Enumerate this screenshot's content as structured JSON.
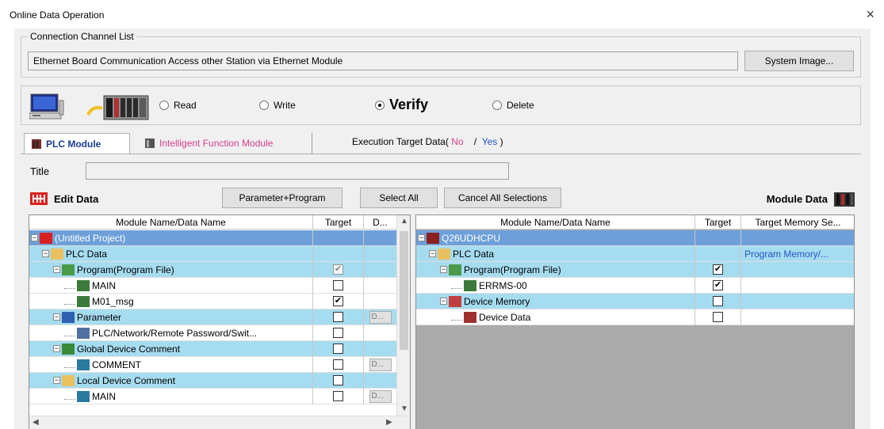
{
  "window": {
    "title": "Online Data Operation",
    "close": "×"
  },
  "channel": {
    "group_label": "Connection Channel List",
    "text": "Ethernet Board Communication  Access other Station via Ethernet Module",
    "system_image_label": "System Image..."
  },
  "operation": {
    "read": "Read",
    "write": "Write",
    "verify": "Verify",
    "delete": "Delete",
    "selected": "Verify"
  },
  "tabs": {
    "plc_module": "PLC Module",
    "intelligent": "Intelligent Function Module",
    "exec_prefix": "Execution Target Data(",
    "exec_no": "No",
    "exec_sep": "/",
    "exec_yes": "Yes",
    "exec_suffix": ")"
  },
  "title_field": {
    "label": "Title",
    "value": ""
  },
  "toolbar": {
    "edit_data": "Edit Data",
    "param_program": "Parameter+Program",
    "select_all": "Select All",
    "cancel_all": "Cancel All Selections",
    "module_data": "Module Data"
  },
  "left_grid": {
    "headers": [
      "Module Name/Data Name",
      "Target",
      "D..."
    ],
    "rows": [
      {
        "label": "(Untitled Project)",
        "level": 0,
        "style": "sel",
        "icon": "project-icon",
        "target": "",
        "detail": ""
      },
      {
        "label": "PLC Data",
        "level": 1,
        "style": "blue",
        "icon": "folder-icon",
        "target": "",
        "detail": ""
      },
      {
        "label": "Program(Program File)",
        "level": 2,
        "style": "blue",
        "icon": "program-icon",
        "target": "grey",
        "detail": ""
      },
      {
        "label": "MAIN",
        "level": 3,
        "style": "white",
        "icon": "program-file-icon",
        "target": "empty",
        "detail": ""
      },
      {
        "label": "M01_msg",
        "level": 3,
        "style": "white",
        "icon": "program-file-icon",
        "target": "checked",
        "detail": ""
      },
      {
        "label": "Parameter",
        "level": 2,
        "style": "blue",
        "icon": "parameter-icon",
        "target": "empty",
        "detail": "D..."
      },
      {
        "label": "PLC/Network/Remote Password/Swit...",
        "level": 3,
        "style": "white",
        "icon": "parameter-file-icon",
        "target": "empty",
        "detail": ""
      },
      {
        "label": "Global Device Comment",
        "level": 2,
        "style": "blue",
        "icon": "comment-icon",
        "target": "empty",
        "detail": ""
      },
      {
        "label": "COMMENT",
        "level": 3,
        "style": "white",
        "icon": "comment-file-icon",
        "target": "empty",
        "detail": "D..."
      },
      {
        "label": "Local Device Comment",
        "level": 2,
        "style": "blue",
        "icon": "folder-icon",
        "target": "empty",
        "detail": ""
      },
      {
        "label": "MAIN",
        "level": 3,
        "style": "white",
        "icon": "comment-file-icon",
        "target": "empty",
        "detail": "D..."
      }
    ]
  },
  "right_grid": {
    "headers": [
      "Module Name/Data Name",
      "Target",
      "Target Memory Se..."
    ],
    "rows": [
      {
        "label": "Q26UDHCPU",
        "level": 0,
        "style": "sel",
        "icon": "cpu-icon",
        "target": "",
        "memory": ""
      },
      {
        "label": "PLC Data",
        "level": 1,
        "style": "blue",
        "icon": "folder-icon",
        "target": "",
        "memory": "Program Memory/..."
      },
      {
        "label": "Program(Program File)",
        "level": 2,
        "style": "blue",
        "icon": "program-icon",
        "target": "checked",
        "memory": ""
      },
      {
        "label": "ERRMS-00",
        "level": 3,
        "style": "white",
        "icon": "program-file-icon",
        "target": "checked",
        "memory": ""
      },
      {
        "label": "Device Memory",
        "level": 2,
        "style": "blue",
        "icon": "device-memory-icon",
        "target": "empty",
        "memory": ""
      },
      {
        "label": "Device Data",
        "level": 3,
        "style": "white",
        "icon": "device-data-icon",
        "target": "empty",
        "memory": ""
      }
    ]
  }
}
